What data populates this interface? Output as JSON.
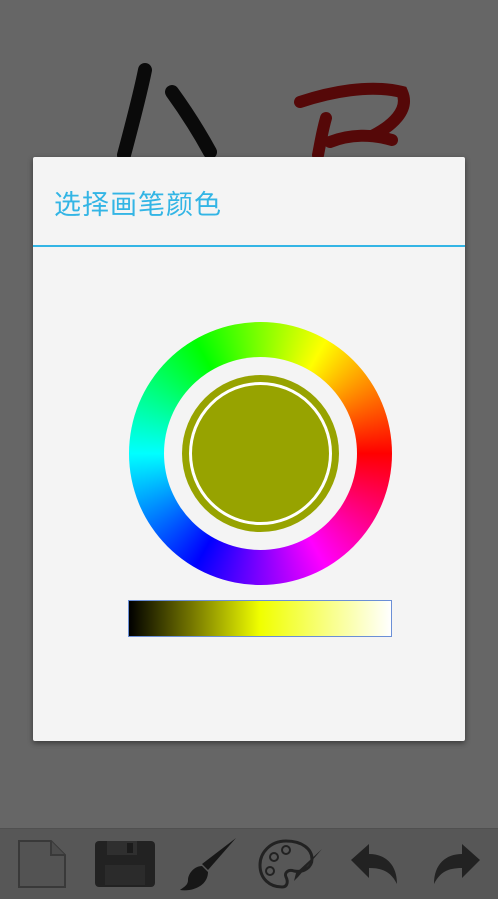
{
  "dialog": {
    "title": "选择画笔颜色"
  },
  "color_picker": {
    "selected_color": "#97A300",
    "ring_hues": [
      "#FF0000",
      "#FF00FF",
      "#0000FF",
      "#00FFFF",
      "#00FF00",
      "#FFFF00"
    ],
    "brightness_gradient": [
      "#000000",
      "#F0FF00",
      "#FFFFFF"
    ]
  },
  "canvas": {
    "strokes": [
      {
        "color": "#1a1a1a"
      },
      {
        "color": "#1a1a1a"
      },
      {
        "color": "#d41414"
      }
    ]
  },
  "toolbar": {
    "icons": [
      "new-page-icon",
      "save-icon",
      "brush-icon",
      "palette-icon",
      "undo-icon",
      "redo-icon"
    ]
  },
  "colors": {
    "accent": "#33B5E5",
    "overlay": "rgba(0,0,0,0.6)"
  }
}
